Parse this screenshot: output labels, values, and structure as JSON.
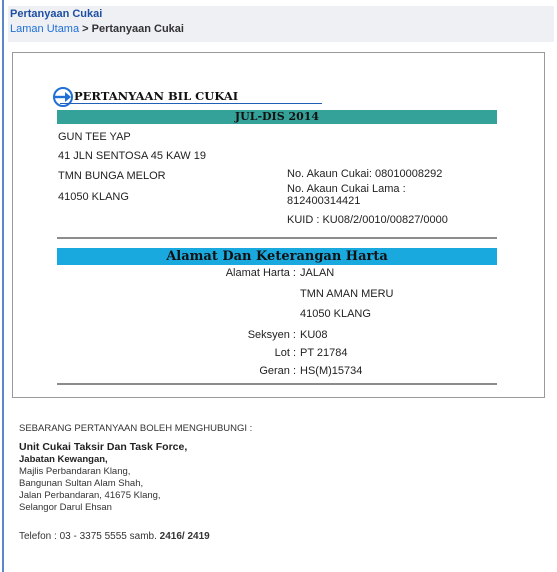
{
  "page": {
    "title": "Pertanyaan Cukai",
    "breadcrumb": {
      "home": "Laman Utama",
      "separator": " > ",
      "current": "Pertanyaan Cukai"
    }
  },
  "bill": {
    "heading": "PERTANYAAN BIL CUKAI",
    "period": "JUL-DIS 2014",
    "owner_name": "GUN TEE YAP",
    "address_line1": "41 JLN SENTOSA 45 KAW 19",
    "address_line2": "TMN BUNGA MELOR",
    "address_line3": "41050 KLANG",
    "account_no": "No. Akaun Cukai: 08010008292",
    "old_account_label": "No. Akaun Cukai Lama :",
    "old_account_value": "812400314421",
    "kuid": "KUID : KU08/2/0010/00827/0000"
  },
  "property": {
    "heading": "Alamat Dan Keterangan Harta",
    "address_label": "Alamat Harta :",
    "address_lines": [
      "JALAN",
      "TMN AMAN MERU",
      "41050 KLANG"
    ],
    "seksyen_label": "Seksyen :",
    "seksyen_value": "KU08",
    "lot_label": "Lot :",
    "lot_value": "PT 21784",
    "geran_label": "Geran :",
    "geran_value": "HS(M)15734"
  },
  "contact": {
    "intro": "SEBARANG PERTANYAAN BOLEH MENGHUBUNGI :",
    "unit": "Unit Cukai Taksir Dan Task Force,",
    "dept": "Jabatan Kewangan,",
    "lines": [
      "Majlis Perbandaran Klang,",
      "Bangunan Sultan Alam Shah,",
      "Jalan Perbandaran, 41675 Klang,",
      "Selangor Darul Ehsan"
    ],
    "phone_prefix": "Telefon : 03 - 3375 5555 samb. ",
    "phone_ext": "2416/ 2419"
  },
  "colors": {
    "teal": "#35a29a",
    "cyan": "#1aa9df",
    "link": "#1f6fd6"
  }
}
